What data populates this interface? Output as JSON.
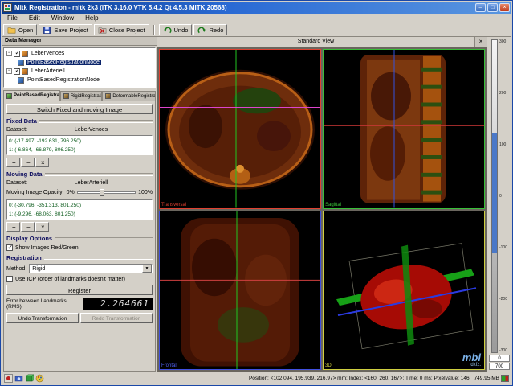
{
  "window": {
    "title": "Mitk Registration - mitk 2k3 (ITK 3.16.0 VTK 5.4.2 Qt 4.5.3 MITK 20568)"
  },
  "icons": {
    "minimize": "–",
    "maximize": "□",
    "close": "×",
    "expander": "−",
    "dropdown": "▼",
    "check": "✓",
    "add": "+",
    "remove": "−",
    "clear": "×",
    "tab_close": "×"
  },
  "menu": {
    "items": [
      {
        "label": "File"
      },
      {
        "label": "Edit"
      },
      {
        "label": "Window"
      },
      {
        "label": "Help"
      }
    ]
  },
  "toolbar": {
    "buttons": [
      {
        "label": "Open"
      },
      {
        "label": "Save Project"
      },
      {
        "label": "Close Project"
      },
      {
        "label": "Undo"
      },
      {
        "label": "Redo"
      }
    ]
  },
  "data_manager": {
    "title": "Data Manager",
    "nodes": [
      {
        "label": "LeberVenoes"
      },
      {
        "label": "PointBasedRegistrationNode"
      },
      {
        "label": "LeberArteriell"
      },
      {
        "label": "PointBasedRegistrationNode"
      }
    ]
  },
  "tabs": {
    "items": [
      {
        "label": "PointBasedRegistration"
      },
      {
        "label": "RigidRegistration"
      },
      {
        "label": "DeformableRegistration"
      }
    ]
  },
  "panel": {
    "switch_button": "Switch Fixed and moving Image",
    "fixed": {
      "title": "Fixed Data",
      "dataset_label": "Dataset:",
      "dataset": "LeberVenoes",
      "points": [
        "0: (-17.497, -192.631, 796.250)",
        "1: (-6.864, -66.879, 806.250)"
      ]
    },
    "moving": {
      "title": "Moving Data",
      "dataset_label": "Dataset:",
      "dataset": "LeberArteriell",
      "opacity_label": "Moving Image Opacity:",
      "opacity_min": "0%",
      "opacity_max": "100%",
      "points": [
        "0: (-30.796, -351.313, 801.250)",
        "1: (-9.296, -68.063, 801.250)"
      ]
    },
    "display": {
      "title": "Display Options",
      "checkbox_label": "Show Images Red/Green"
    },
    "registration": {
      "title": "Registration",
      "method_label": "Method:",
      "method_value": "Rigid",
      "icp_label": "Use ICP (order of landmarks doesn't matter)",
      "register_button": "Register"
    },
    "rms_label": "Error between Landmarks (RMS):",
    "rms_value": "2.264661",
    "undo_button": "Undo Transformation",
    "redo_button": "Redo Transformation"
  },
  "viewer": {
    "tab_label": "Standard View",
    "views": [
      {
        "name": "Transversal",
        "color": "#e04030"
      },
      {
        "name": "Sagittal",
        "color": "#38c038"
      },
      {
        "name": "Frontal",
        "color": "#4050e0"
      },
      {
        "name": "3D",
        "color": "#d0d040"
      }
    ],
    "logo": {
      "line1": "mbi",
      "line2": "dkfz."
    }
  },
  "level_window": {
    "ticks": [
      "300",
      "200",
      "100",
      "0",
      "-100",
      "-200",
      "-300"
    ],
    "level": "0",
    "window": "700"
  },
  "status": {
    "text": "Position: <102.094, 195.939, 216.97> mm; Index: <160, 260, 167>; Time: 0 ms; Pixelvalue: 146",
    "memory": "749.95 MB"
  }
}
